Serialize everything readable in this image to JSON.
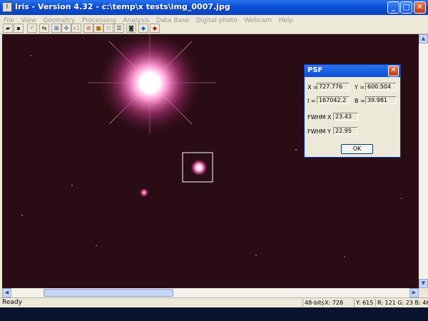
{
  "window": {
    "title": "Iris - Version 4.32 - c:\\temp\\x tests\\img_0007.jpg",
    "minimize_glyph": "_",
    "maximize_glyph": "□",
    "close_glyph": "✕",
    "app_icon_glyph": "I"
  },
  "menu": {
    "items": [
      "File",
      "View",
      "Geometry",
      "Processing",
      "Analysis",
      "Data Base",
      "Digital photo",
      "Webcam",
      "Help"
    ]
  },
  "toolbar": {
    "buttons": [
      {
        "name": "open-icon",
        "glyph": "▰"
      },
      {
        "name": "save-icon",
        "glyph": "▪"
      },
      {
        "name": "undo-icon",
        "glyph": "↶"
      },
      {
        "name": "swap-icon",
        "glyph": "⇆"
      },
      {
        "name": "zoom-box-icon",
        "glyph": "⊞"
      },
      {
        "name": "move-icon",
        "glyph": "✣"
      },
      {
        "name": "scale-x1-icon",
        "glyph": "x1"
      },
      {
        "name": "stop-icon",
        "glyph": "⊘"
      },
      {
        "name": "box-icon",
        "glyph": "■"
      },
      {
        "name": "histogram-icon",
        "glyph": "H"
      },
      {
        "name": "list-icon",
        "glyph": "☰"
      },
      {
        "name": "camera-icon",
        "glyph": "◙"
      },
      {
        "name": "diamond-blue-icon",
        "glyph": "◆"
      },
      {
        "name": "diamond-red-icon",
        "glyph": "◆"
      }
    ]
  },
  "status": {
    "ready": "Ready",
    "bits": "48-bits",
    "x": "X: 728",
    "y": "Y: 615",
    "rgb": "R: 121  G: 23  B: 46"
  },
  "psf_dialog": {
    "title": "PSF",
    "close_glyph": "✕",
    "x_label": "X =",
    "x_value": "727.776",
    "y_label": "Y =",
    "y_value": "600.504",
    "i_label": "I =",
    "i_value": "167042.2",
    "b_label": "B =",
    "b_value": "39.981",
    "fwhm_x_label": "FWHM X =",
    "fwhm_x_value": "23.43",
    "fwhm_y_label": "FWHM Y =",
    "fwhm_y_value": "22.95",
    "ok_label": "OK"
  },
  "scroll": {
    "up": "▲",
    "down": "▼",
    "left": "◀",
    "right": "▶"
  },
  "colors": {
    "image_background": "#2a0c14",
    "star_core": "#ffffff",
    "star_glow": "#ff4fa8",
    "selection_box": "#ffffff"
  }
}
